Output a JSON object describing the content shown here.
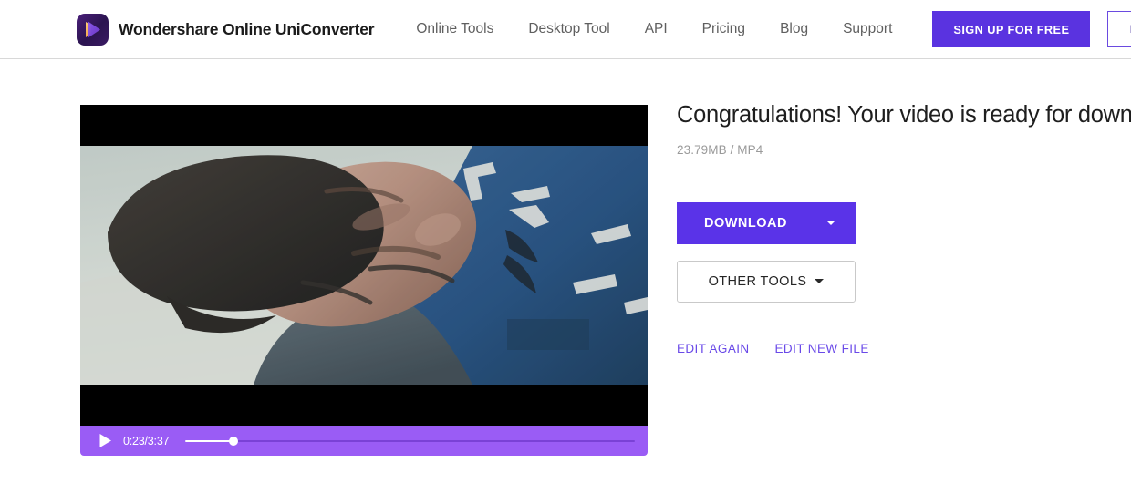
{
  "header": {
    "brand_name": "Wondershare Online UniConverter",
    "logo_icon": "play-logo-icon",
    "nav_items": [
      {
        "label": "Online Tools"
      },
      {
        "label": "Desktop Tool"
      },
      {
        "label": "API"
      },
      {
        "label": "Pricing"
      },
      {
        "label": "Blog"
      },
      {
        "label": "Support"
      }
    ],
    "signup_label": "SIGN UP FOR FREE",
    "login_label": "LOG IN",
    "search_icon": "search-icon"
  },
  "player": {
    "play_icon": "play-icon",
    "time_label": "0:23/3:37",
    "current_time": "0:23",
    "duration": "3:37",
    "progress_percent": 10.6
  },
  "result": {
    "title": "Congratulations! Your video is ready for download!",
    "file_meta": "23.79MB / MP4",
    "file_size": "23.79MB",
    "file_format": "MP4",
    "download_label": "DOWNLOAD",
    "other_tools_label": "OTHER TOOLS",
    "edit_again_label": "EDIT AGAIN",
    "edit_new_file_label": "EDIT NEW FILE"
  },
  "colors": {
    "brand_purple": "#5a33e0",
    "download_purple": "#5a33e8",
    "control_bar_purple": "#9a5cf5",
    "link_purple": "#6a4ae8",
    "muted_text": "#9a9a9a"
  }
}
